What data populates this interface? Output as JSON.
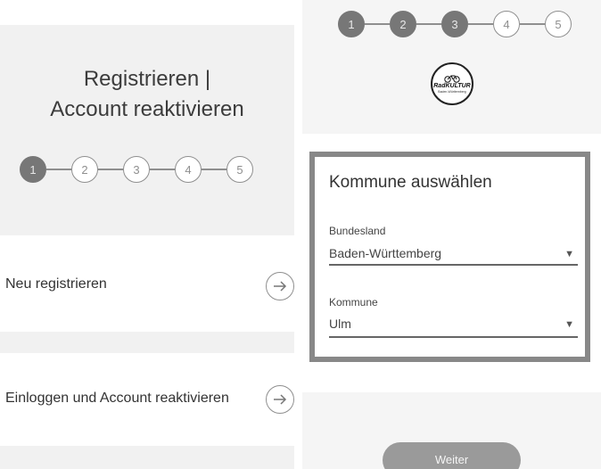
{
  "left": {
    "title_line1": "Registrieren   |",
    "title_line2": "Account reaktivieren",
    "steps": [
      "1",
      "2",
      "3",
      "4",
      "5"
    ],
    "option_register": "Neu registrieren",
    "option_login": "Einloggen und Account reaktivieren"
  },
  "right": {
    "steps": [
      "1",
      "2",
      "3",
      "4",
      "5"
    ],
    "logo": {
      "name": "RadKULTUR",
      "subtitle": "Baden-Württemberg"
    },
    "form": {
      "title": "Kommune auswählen",
      "bundesland_label": "Bundesland",
      "bundesland_value": "Baden-Württemberg",
      "kommune_label": "Kommune",
      "kommune_value": "Ulm"
    },
    "next_button": "Weiter"
  }
}
